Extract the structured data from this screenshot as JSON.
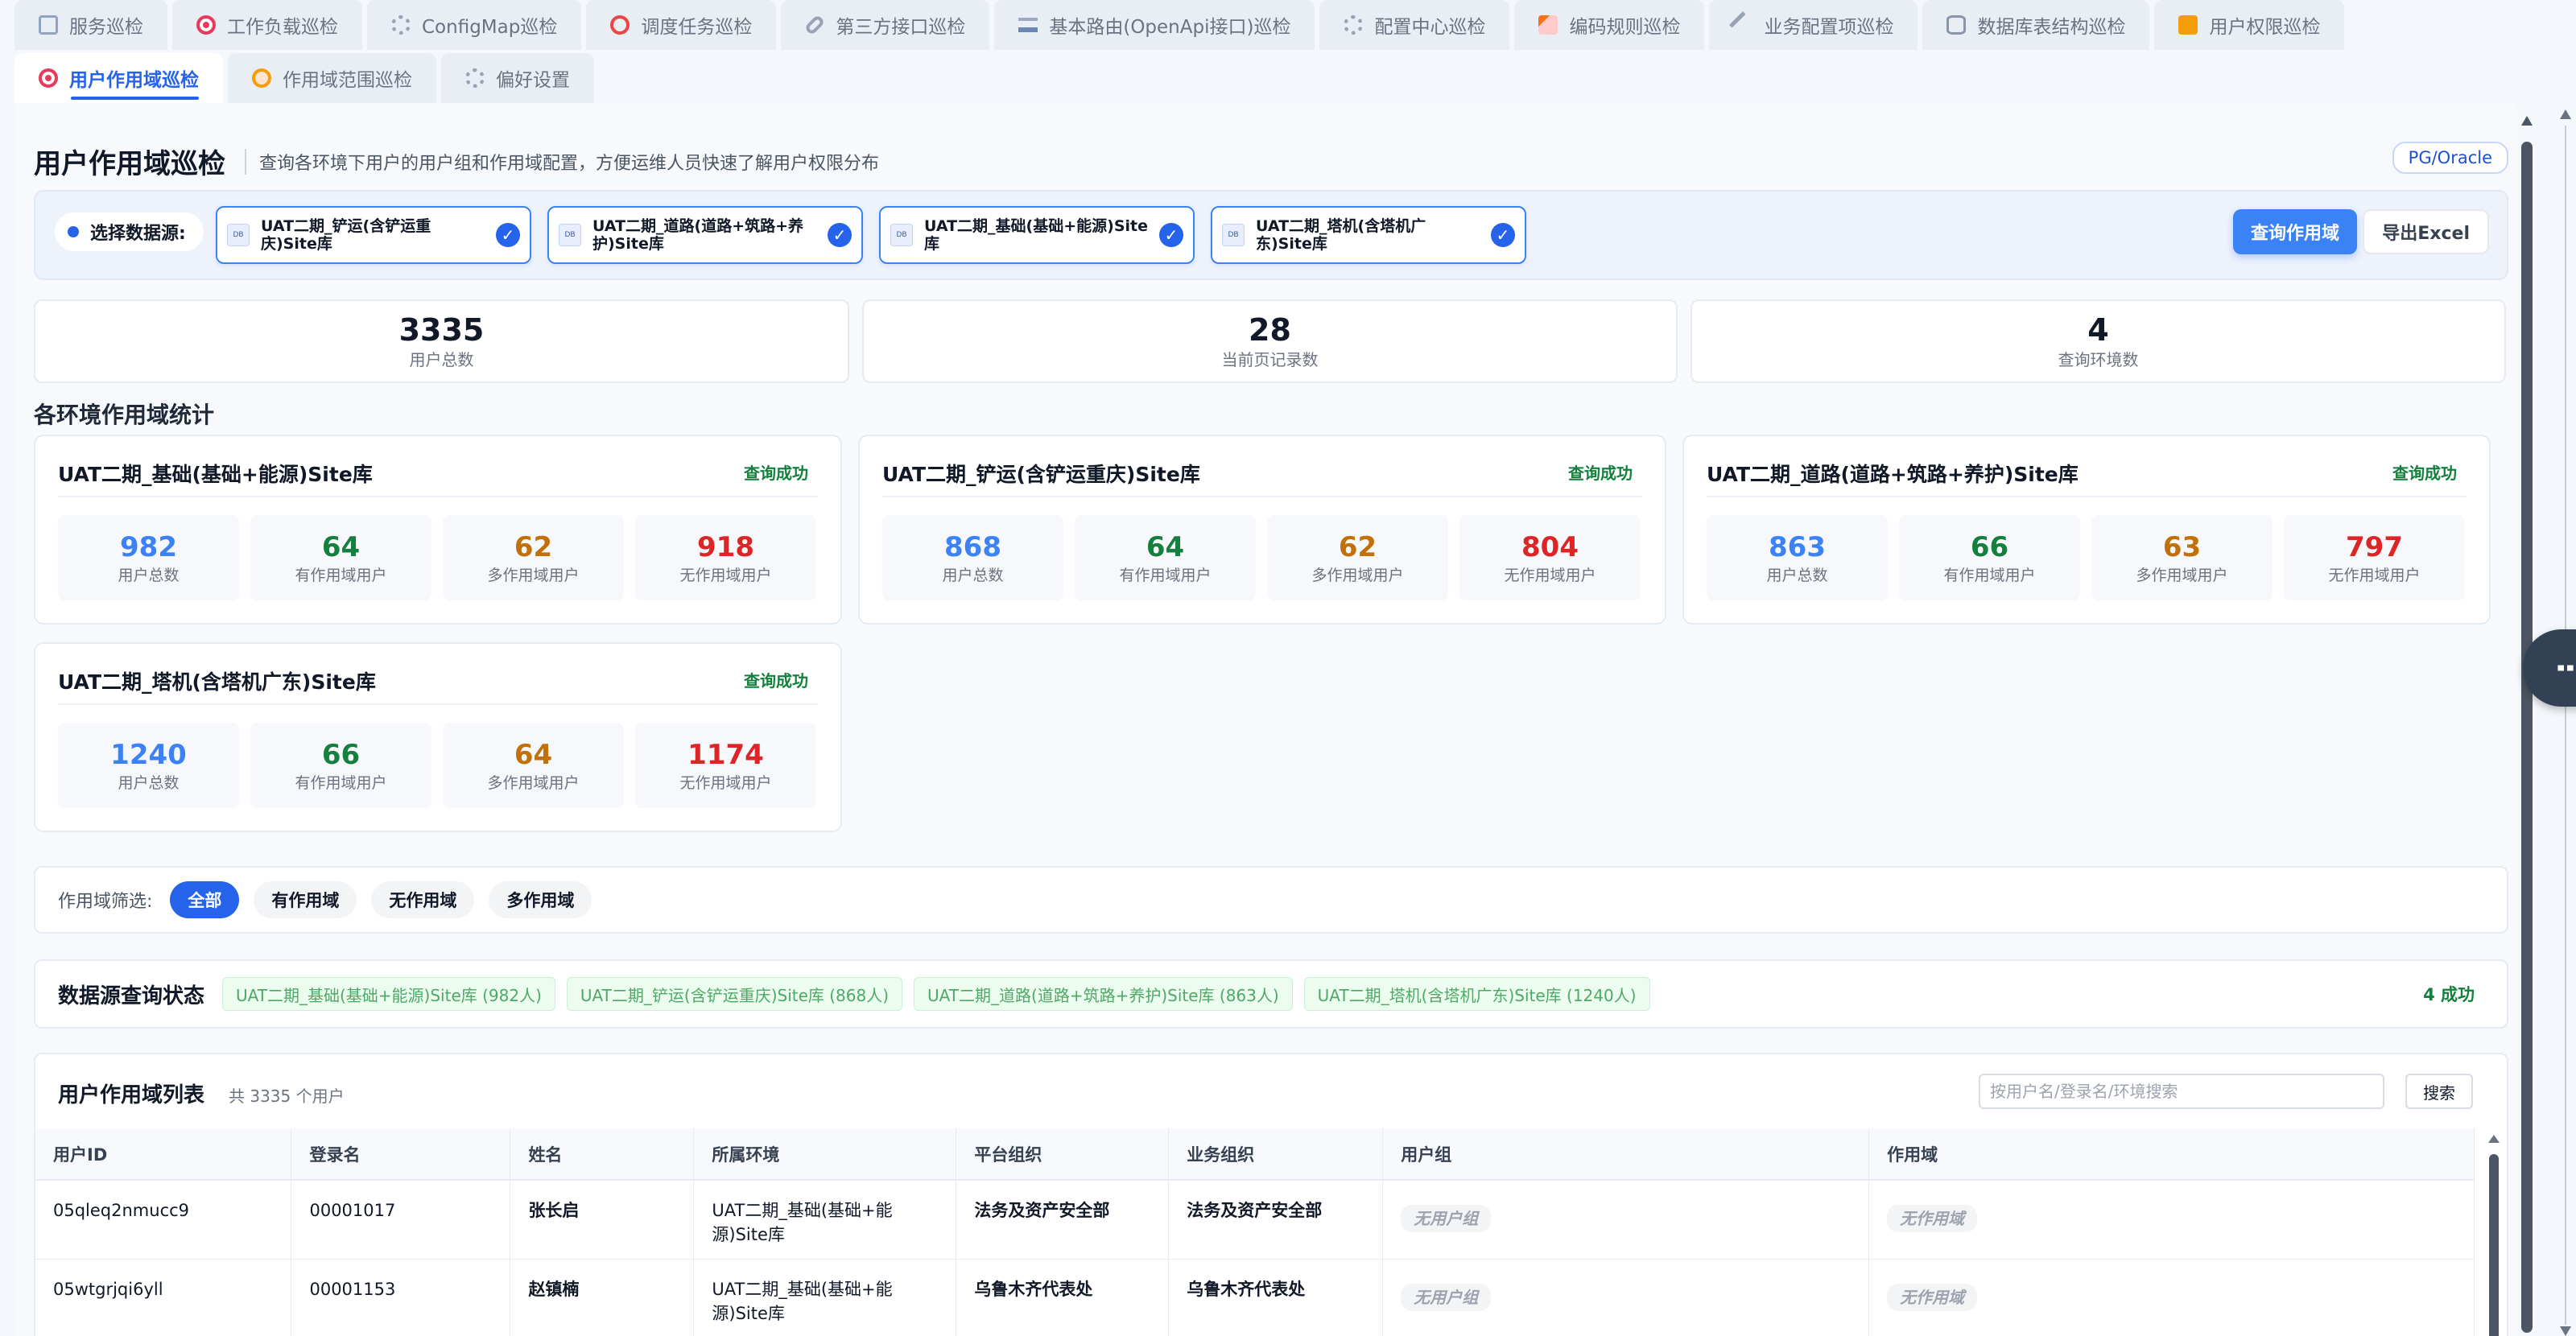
{
  "tabs": {
    "row1": [
      {
        "label": "服务巡检",
        "icon": "document-icon",
        "cls": "ic-doc"
      },
      {
        "label": "工作负载巡检",
        "icon": "target-icon",
        "cls": "ic-target"
      },
      {
        "label": "ConfigMap巡检",
        "icon": "gear-icon",
        "cls": "ic-gear"
      },
      {
        "label": "调度任务巡检",
        "icon": "alarm-clock-icon",
        "cls": "ic-clock"
      },
      {
        "label": "第三方接口巡检",
        "icon": "link-icon",
        "cls": "ic-link"
      },
      {
        "label": "基本路由(OpenApi接口)巡检",
        "icon": "road-icon",
        "cls": "ic-route"
      },
      {
        "label": "配置中心巡检",
        "icon": "gear-icon",
        "cls": "ic-gear"
      },
      {
        "label": "编码规则巡检",
        "icon": "memo-icon",
        "cls": "ic-pen"
      },
      {
        "label": "业务配置项巡检",
        "icon": "wrench-icon",
        "cls": "ic-wrench"
      },
      {
        "label": "数据库表结构巡检",
        "icon": "database-icon",
        "cls": "ic-db"
      },
      {
        "label": "用户权限巡检",
        "icon": "lock-icon",
        "cls": "ic-lock"
      }
    ],
    "row2": [
      {
        "label": "用户作用域巡检",
        "icon": "target-icon",
        "cls": "ic-target",
        "active": true
      },
      {
        "label": "作用域范围巡检",
        "icon": "globe-icon",
        "cls": "ic-globe"
      },
      {
        "label": "偏好设置",
        "icon": "gear-icon",
        "cls": "ic-gear"
      }
    ]
  },
  "header": {
    "title": "用户作用域巡检",
    "subtitle": "查询各环境下用户的用户组和作用域配置，方便运维人员快速了解用户权限分布",
    "db_type": "PG/Oracle"
  },
  "datasource": {
    "label": "选择数据源:",
    "chips": [
      {
        "name": "UAT二期_铲运(含铲运重庆)Site库",
        "tag": "DB"
      },
      {
        "name": "UAT二期_道路(道路+筑路+养护)Site库",
        "tag": "DB"
      },
      {
        "name": "UAT二期_基础(基础+能源)Site库",
        "tag": "DB"
      },
      {
        "name": "UAT二期_塔机(含塔机广东)Site库",
        "tag": "DB"
      }
    ],
    "check": "✓",
    "query_button": "查询作用域",
    "export_button": "导出Excel"
  },
  "summary": [
    {
      "value": "3335",
      "label": "用户总数"
    },
    {
      "value": "28",
      "label": "当前页记录数"
    },
    {
      "value": "4",
      "label": "查询环境数"
    }
  ],
  "env_section_title": "各环境作用域统计",
  "env_cards": [
    {
      "name": "UAT二期_基础(基础+能源)Site库",
      "status": "查询成功",
      "stats": [
        {
          "value": "982",
          "label": "用户总数"
        },
        {
          "value": "64",
          "label": "有作用域用户"
        },
        {
          "value": "62",
          "label": "多作用域用户"
        },
        {
          "value": "918",
          "label": "无作用域用户"
        }
      ]
    },
    {
      "name": "UAT二期_铲运(含铲运重庆)Site库",
      "status": "查询成功",
      "stats": [
        {
          "value": "868",
          "label": "用户总数"
        },
        {
          "value": "64",
          "label": "有作用域用户"
        },
        {
          "value": "62",
          "label": "多作用域用户"
        },
        {
          "value": "804",
          "label": "无作用域用户"
        }
      ]
    },
    {
      "name": "UAT二期_道路(道路+筑路+养护)Site库",
      "status": "查询成功",
      "stats": [
        {
          "value": "863",
          "label": "用户总数"
        },
        {
          "value": "66",
          "label": "有作用域用户"
        },
        {
          "value": "63",
          "label": "多作用域用户"
        },
        {
          "value": "797",
          "label": "无作用域用户"
        }
      ]
    },
    {
      "name": "UAT二期_塔机(含塔机广东)Site库",
      "status": "查询成功",
      "stats": [
        {
          "value": "1240",
          "label": "用户总数"
        },
        {
          "value": "66",
          "label": "有作用域用户"
        },
        {
          "value": "64",
          "label": "多作用域用户"
        },
        {
          "value": "1174",
          "label": "无作用域用户"
        }
      ]
    }
  ],
  "filter": {
    "label": "作用域筛选:",
    "options": [
      "全部",
      "有作用域",
      "无作用域",
      "多作用域"
    ],
    "selected": "全部"
  },
  "status_bar": {
    "title": "数据源查询状态",
    "tags": [
      "UAT二期_基础(基础+能源)Site库 (982人)",
      "UAT二期_铲运(含铲运重庆)Site库 (868人)",
      "UAT二期_道路(道路+筑路+养护)Site库 (863人)",
      "UAT二期_塔机(含塔机广东)Site库 (1240人)"
    ],
    "count": "4 成功"
  },
  "table": {
    "title": "用户作用域列表",
    "count": "共 3335 个用户",
    "search_placeholder": "按用户名/登录名/环境搜索",
    "search_value": "",
    "search_button": "搜索",
    "columns": [
      "用户ID",
      "登录名",
      "姓名",
      "所属环境",
      "平台组织",
      "业务组织",
      "用户组",
      "作用域"
    ],
    "rows": [
      {
        "id": "05qleq2nmucc9",
        "login": "00001017",
        "name": "张长启",
        "env": "UAT二期_基础(基础+能源)Site库",
        "platform_org": "法务及资产安全部",
        "biz_org": "法务及资产安全部",
        "group": "无用户组",
        "scope": "无作用域"
      },
      {
        "id": "05wtgrjqi6yll",
        "login": "00001153",
        "name": "赵镇楠",
        "env": "UAT二期_基础(基础+能源)Site库",
        "platform_org": "乌鲁木齐代表处",
        "biz_org": "乌鲁木齐代表处",
        "group": "无用户组",
        "scope": "无作用域"
      }
    ]
  },
  "float_menu": {
    "icon": "more-vertical-icon",
    "glyph": "⋮"
  },
  "colors": {
    "accent": "#2563eb",
    "success": "#15803d",
    "warning": "#c2700a",
    "danger": "#dc2626",
    "info": "#3b82f6"
  }
}
